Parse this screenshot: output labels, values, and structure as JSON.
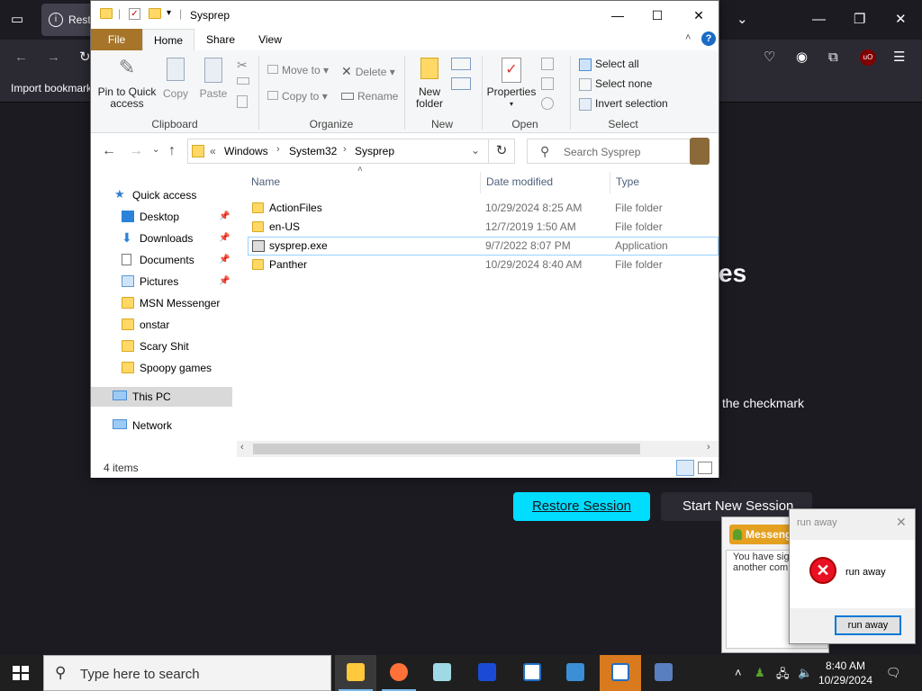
{
  "firefox": {
    "tab_title": "Rest",
    "bookmark": "Import bookmarks",
    "heading_fragment": "es",
    "checkmark_text": "the checkmark",
    "restore_label": "Restore Session",
    "new_session_label": "Start New Session"
  },
  "messenger": {
    "title": "Messenger",
    "body": "You have sig\nanother com"
  },
  "error_dialog": {
    "title": "run away",
    "message": "run away",
    "ok_label": "run away"
  },
  "explorer": {
    "title": "Sysprep",
    "tabs": {
      "file": "File",
      "home": "Home",
      "share": "Share",
      "view": "View"
    },
    "ribbon": {
      "clipboard": {
        "label": "Clipboard",
        "pin": "Pin to Quick access",
        "copy": "Copy",
        "paste": "Paste"
      },
      "organize": {
        "label": "Organize",
        "move_to": "Move to",
        "copy_to": "Copy to",
        "delete": "Delete",
        "rename": "Rename"
      },
      "new": {
        "label": "New",
        "new_folder": "New folder"
      },
      "open": {
        "label": "Open",
        "properties": "Properties"
      },
      "select": {
        "label": "Select",
        "select_all": "Select all",
        "select_none": "Select none",
        "invert": "Invert selection"
      }
    },
    "address": {
      "prefix": "«",
      "crumbs": [
        "Windows",
        "System32",
        "Sysprep"
      ],
      "search_placeholder": "Search Sysprep"
    },
    "nav": [
      {
        "label": "Quick access",
        "icon": "star-icon"
      },
      {
        "label": "Desktop",
        "icon": "desktop-icon",
        "pinned": true
      },
      {
        "label": "Downloads",
        "icon": "download-icon",
        "pinned": true
      },
      {
        "label": "Documents",
        "icon": "document-icon",
        "pinned": true
      },
      {
        "label": "Pictures",
        "icon": "pictures-icon",
        "pinned": true
      },
      {
        "label": "MSN Messenger",
        "icon": "folder-icon"
      },
      {
        "label": "onstar",
        "icon": "folder-icon"
      },
      {
        "label": "Scary Shit",
        "icon": "folder-icon"
      },
      {
        "label": "Spoopy games",
        "icon": "folder-icon"
      },
      {
        "label": "This PC",
        "icon": "computer-icon"
      },
      {
        "label": "Network",
        "icon": "network-icon"
      }
    ],
    "columns": {
      "name": "Name",
      "date": "Date modified",
      "type": "Type"
    },
    "files": [
      {
        "name": "ActionFiles",
        "date": "10/29/2024 8:25 AM",
        "type": "File folder"
      },
      {
        "name": "en-US",
        "date": "12/7/2019 1:50 AM",
        "type": "File folder"
      },
      {
        "name": "sysprep.exe",
        "date": "9/7/2022 8:07 PM",
        "type": "Application"
      },
      {
        "name": "Panther",
        "date": "10/29/2024 8:40 AM",
        "type": "File folder"
      }
    ],
    "status": "4 items"
  },
  "taskbar": {
    "search_placeholder": "Type here to search",
    "time": "8:40 AM",
    "date": "10/29/2024"
  }
}
